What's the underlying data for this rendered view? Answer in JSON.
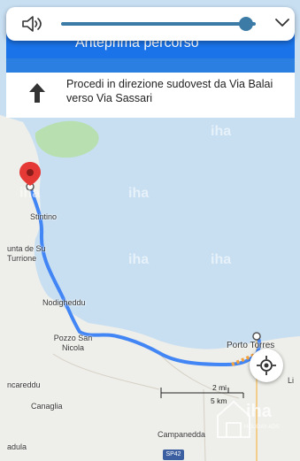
{
  "volume": {
    "level_fraction": 0.95,
    "speaker_icon": "speaker-icon",
    "expand_icon": "chevron-down-icon"
  },
  "header": {
    "title": "Anteprima percorso"
  },
  "step": {
    "text": "Procedi in direzione sudovest da Via Balai verso Via Sassari",
    "icon": "arrow-up-icon"
  },
  "map": {
    "labels": {
      "stintino": "Stintino",
      "torre": "unta de Su Turrione",
      "nodigheddu": "Nodigheddu",
      "pozzo": "Pozzo San Nicola",
      "porto": "Porto Torres",
      "ncareddu": "ncareddu",
      "canaglia": "Canaglia",
      "adula": "adula",
      "campanedda": "Campanedda",
      "lio": "Li"
    },
    "watermark_text": "iha",
    "scale_mi": "2 mi",
    "scale_km": "5 km",
    "road_badge": "SP42",
    "logo_text": "iha",
    "logo_sub": "HOLIDAY-ADS",
    "colors": {
      "route": "#4285f4",
      "land": "#eeeeea",
      "sea": "#c8dff2",
      "pin": "#e53935"
    }
  }
}
